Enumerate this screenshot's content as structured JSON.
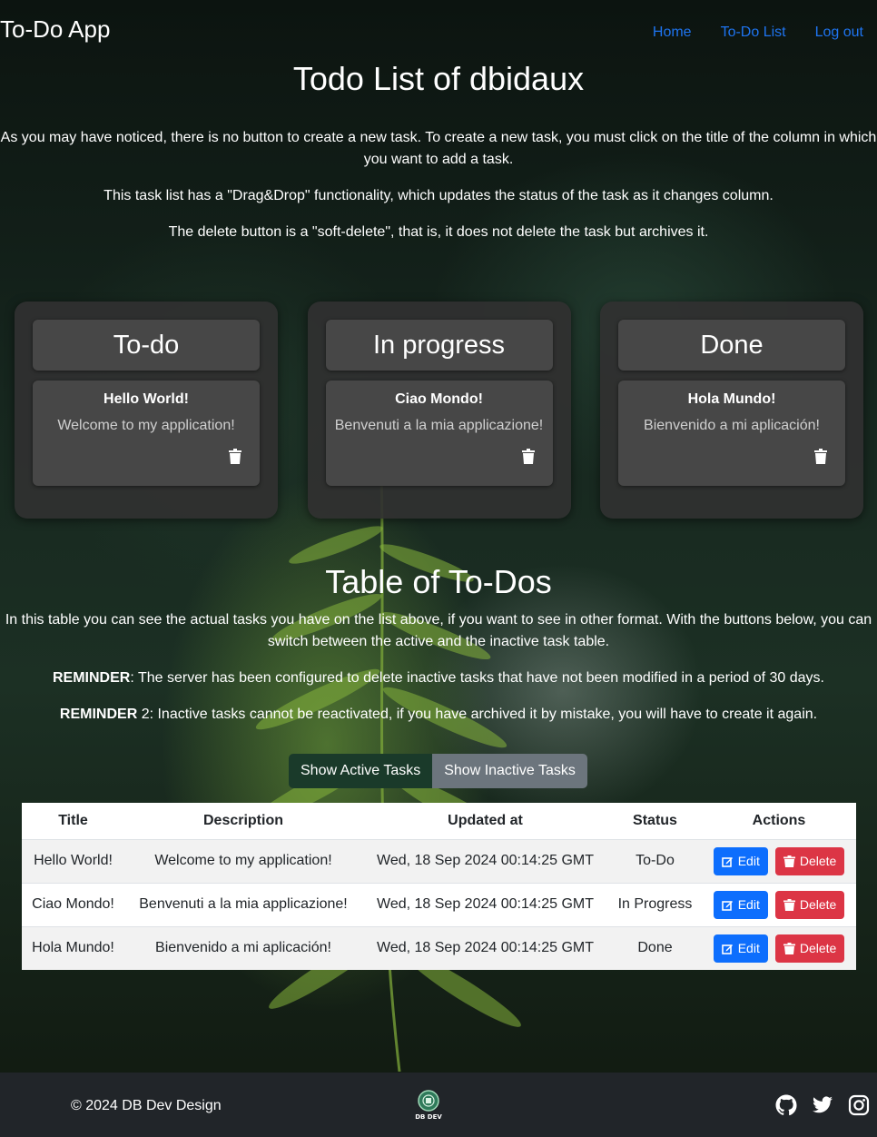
{
  "navbar": {
    "brand": "To-Do App",
    "links": [
      "Home",
      "To-Do List",
      "Log out"
    ]
  },
  "page_title": "Todo List of dbidaux",
  "intro": [
    "As you may have noticed, there is no button to create a new task. To create a new task, you must click on the title of the column in which you want to add a task.",
    "This task list has a \"Drag&Drop\" functionality, which updates the status of the task as it changes column.",
    "The delete button is a \"soft-delete\", that is, it does not delete the task but archives it."
  ],
  "columns": [
    {
      "title": "To-do",
      "task": {
        "title": "Hello World!",
        "description": "Welcome to my application!"
      }
    },
    {
      "title": "In progress",
      "task": {
        "title": "Ciao Mondo!",
        "description": "Benvenuti a la mia applicazione!"
      }
    },
    {
      "title": "Done",
      "task": {
        "title": "Hola Mundo!",
        "description": "Bienvenido a mi aplicación!"
      }
    }
  ],
  "table_section": {
    "title": "Table of To-Dos",
    "intro": "In this table you can see the actual tasks you have on the list above, if you want to see in other format. With the buttons below, you can switch between the active and the inactive task table.",
    "reminder1_bold": "REMINDER",
    "reminder1_text": ": The server has been configured to delete inactive tasks that have not been modified in a period of 30 days.",
    "reminder2_bold": "REMINDER",
    "reminder2_text": " 2: Inactive tasks cannot be reactivated, if you have archived it by mistake, you will have to create it again.",
    "btn_active": "Show Active Tasks",
    "btn_inactive": "Show Inactive Tasks"
  },
  "table": {
    "headers": [
      "Title",
      "Description",
      "Updated at",
      "Status",
      "Actions"
    ],
    "rows": [
      {
        "title": "Hello World!",
        "description": "Welcome to my application!",
        "updated": "Wed, 18 Sep 2024 00:14:25 GMT",
        "status": "To-Do"
      },
      {
        "title": "Ciao Mondo!",
        "description": "Benvenuti a la mia applicazione!",
        "updated": "Wed, 18 Sep 2024 00:14:25 GMT",
        "status": "In Progress"
      },
      {
        "title": "Hola Mundo!",
        "description": "Bienvenido a mi aplicación!",
        "updated": "Wed, 18 Sep 2024 00:14:25 GMT",
        "status": "Done"
      }
    ],
    "edit_label": "Edit",
    "delete_label": "Delete"
  },
  "footer": {
    "copyright": "© 2024 DB Dev Design",
    "logo_text": "DB DEV",
    "socials": [
      "github-icon",
      "twitter-icon",
      "instagram-icon"
    ]
  },
  "colors": {
    "nav_link": "#1e74f0",
    "edit": "#0d6efd",
    "delete": "#dc3545",
    "footer": "#212529"
  }
}
